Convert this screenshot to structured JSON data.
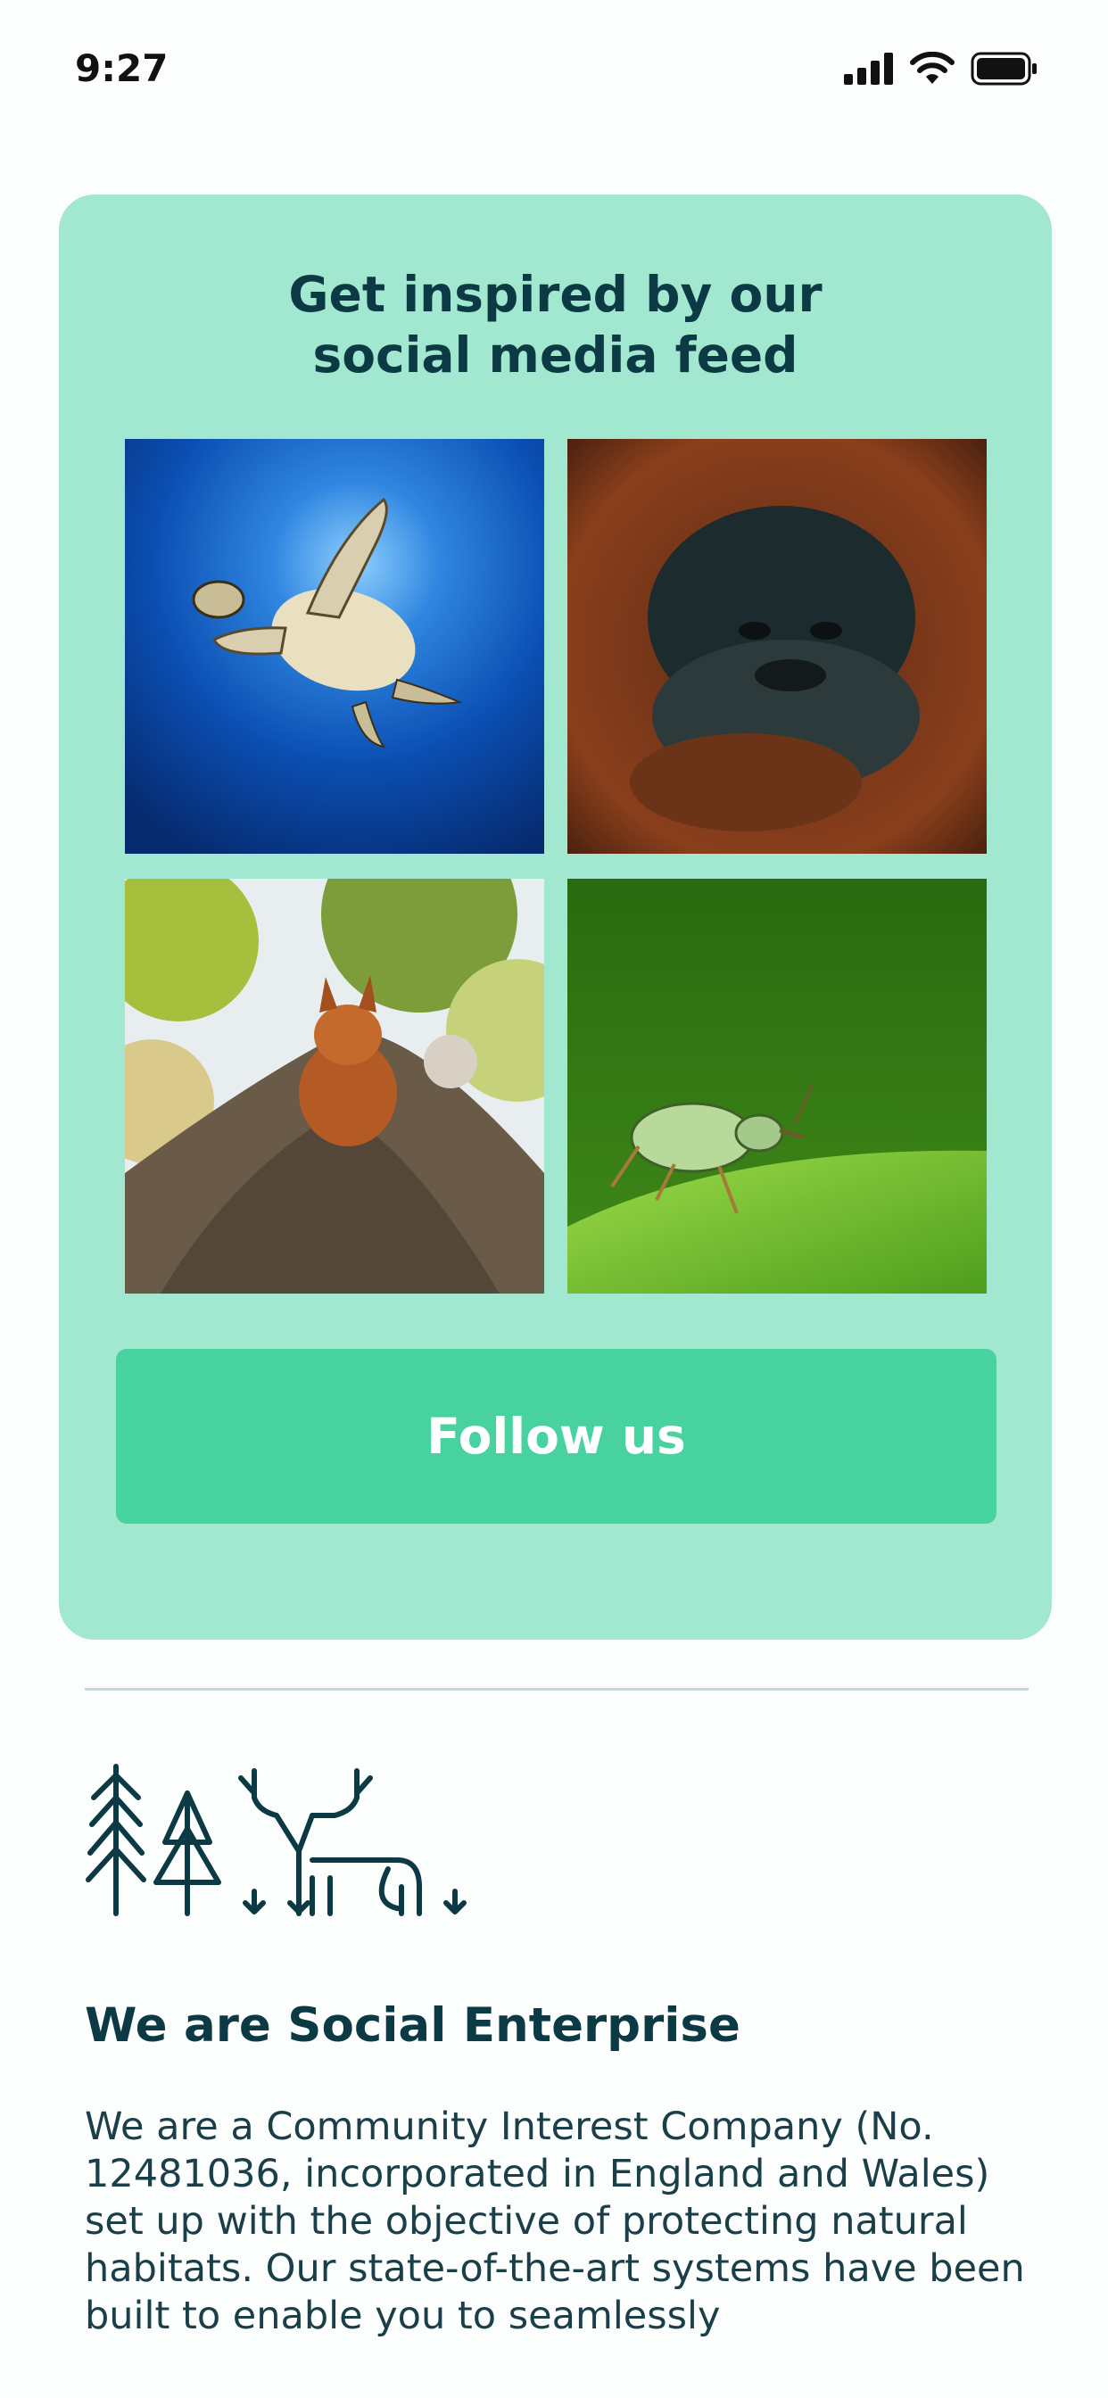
{
  "status_bar": {
    "time": "9:27",
    "icons": [
      "signal-icon",
      "wifi-icon",
      "battery-icon"
    ]
  },
  "social_card": {
    "title_line1": "Get inspired by our",
    "title_line2": "social media feed",
    "photos": [
      "sea-turtle-photo",
      "orangutan-photo",
      "red-squirrel-photo",
      "green-beetle-photo"
    ],
    "follow_label": "Follow us"
  },
  "about": {
    "illustration": "trees-deer-cow-icon",
    "heading": "We are Social Enterprise",
    "body": "We are a Community Interest Company (No. 12481036, incorporated in England and Wales) set up with the objective of protecting natural habitats. Our state-of-the-art systems have been built to enable you to seamlessly"
  },
  "colors": {
    "card_bg": "#a2e7cf",
    "button_bg": "#48d29f",
    "text_dark": "#0b3a44"
  }
}
